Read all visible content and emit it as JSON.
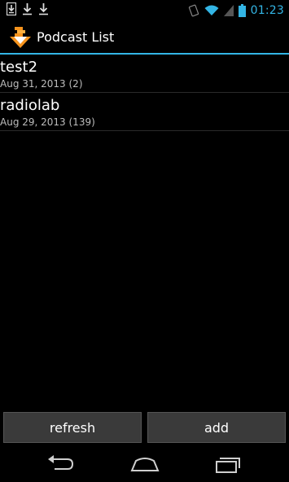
{
  "status_bar": {
    "time": "01:23",
    "accent": "#33b5e5",
    "left_icons": [
      "sd-card-download-icon",
      "download-icon",
      "download-icon"
    ],
    "right_icons": [
      "screen-rotation-icon",
      "wifi-icon",
      "signal-icon",
      "battery-icon"
    ]
  },
  "action_bar": {
    "title": "Podcast List",
    "icon": "app-logo-icon"
  },
  "podcasts": [
    {
      "name": "test2",
      "meta": "Aug 31, 2013 (2)"
    },
    {
      "name": "radiolab",
      "meta": "Aug 29, 2013 (139)"
    }
  ],
  "buttons": {
    "refresh": "refresh",
    "add": "add"
  },
  "nav_bar": {
    "icons": [
      "back-icon",
      "home-icon",
      "recent-apps-icon"
    ]
  }
}
